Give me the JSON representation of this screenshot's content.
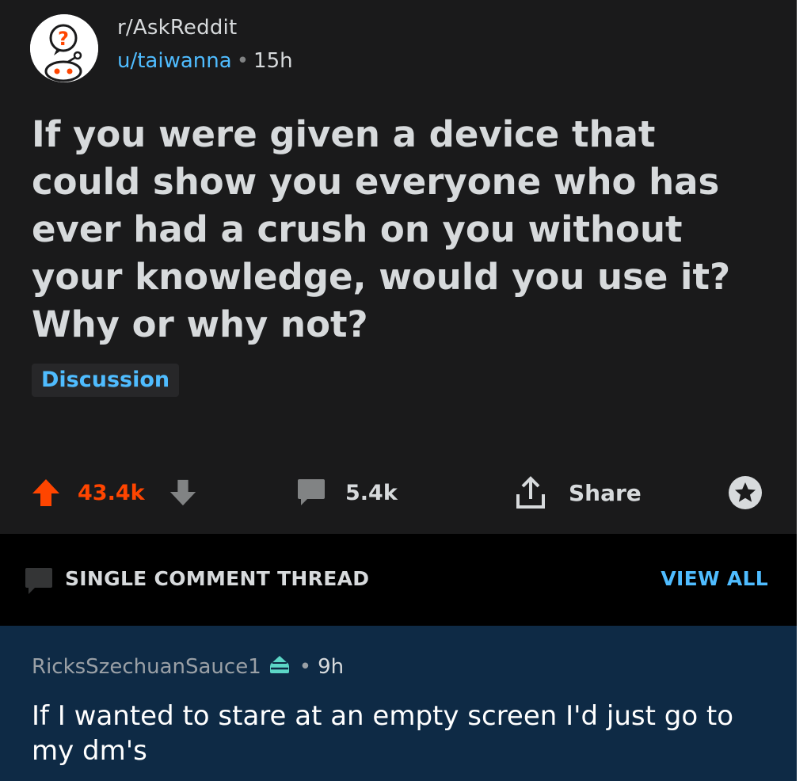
{
  "post": {
    "subreddit": "r/AskReddit",
    "author": "u/taiwanna",
    "separator": "•",
    "age": "15h",
    "title": "If you were given a device that could show you everyone who has ever had a crush on you without your knowledge, would you use it? Why or why not?",
    "flair": "Discussion",
    "avatar_glyph": "?",
    "avatar_icon": "askreddit-snoo-icon"
  },
  "actions": {
    "score": "43.4k",
    "comments": "5.4k",
    "share_label": "Share",
    "icons": [
      "upvote-arrow-icon",
      "downvote-arrow-icon",
      "comment-bubble-icon",
      "share-icon",
      "award-icon"
    ]
  },
  "thread": {
    "label": "SINGLE COMMENT THREAD",
    "view_all": "VIEW ALL"
  },
  "comment": {
    "author": "RicksSzechuanSauce1",
    "separator": "•",
    "age": "9h",
    "body": "If I wanted to stare at an empty screen I'd just go to my dm's",
    "flair_icon": "cake-icon"
  },
  "colors": {
    "background": "#1a1a1b",
    "text": "#d7dadc",
    "link_blue": "#4fbcff",
    "upvote_orange": "#ff4500",
    "thread_bar": "#000000",
    "comment_highlight": "#0e2a45",
    "cake_teal": "#5cd6c6"
  }
}
